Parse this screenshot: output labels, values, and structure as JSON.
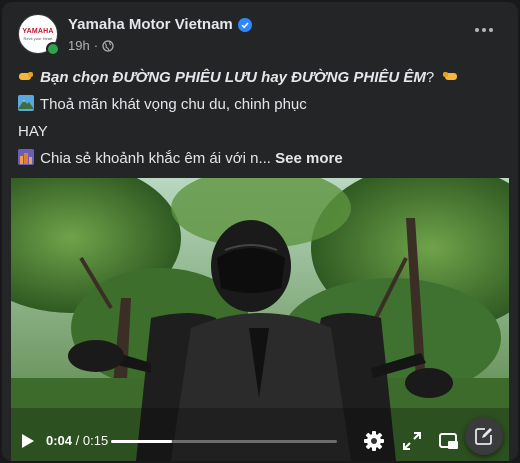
{
  "post": {
    "author": "Yamaha Motor Vietnam",
    "time": "19h",
    "separator": "·",
    "avatar_logo": "YAMAHA",
    "avatar_tagline": "Revs your Heart",
    "lines": {
      "line1_prefix": "Bạn chọn ĐƯỜNG PHIÊU LƯU hay ĐƯỜNG PHIÊU ÊM",
      "line1_suffix": "?",
      "line2": "Thoả mãn khát vọng chu du, chinh phục",
      "line3": "HAY",
      "line4": "Chia sẻ khoảnh khắc êm ái với n...",
      "see_more": "See more"
    }
  },
  "video": {
    "current_time": "0:04",
    "duration": "0:15",
    "time_separator": " / ",
    "progress": 0.27
  },
  "icons": [
    "verified-icon",
    "globe-icon",
    "more-icon",
    "fist-icon",
    "mountain-icon",
    "city-icon",
    "play-icon",
    "settings-icon",
    "fullscreen-icon",
    "pip-icon",
    "compose-icon"
  ],
  "colors": {
    "accent": "#2d88ff",
    "online": "#31a24c",
    "brand": "#c8102e"
  }
}
